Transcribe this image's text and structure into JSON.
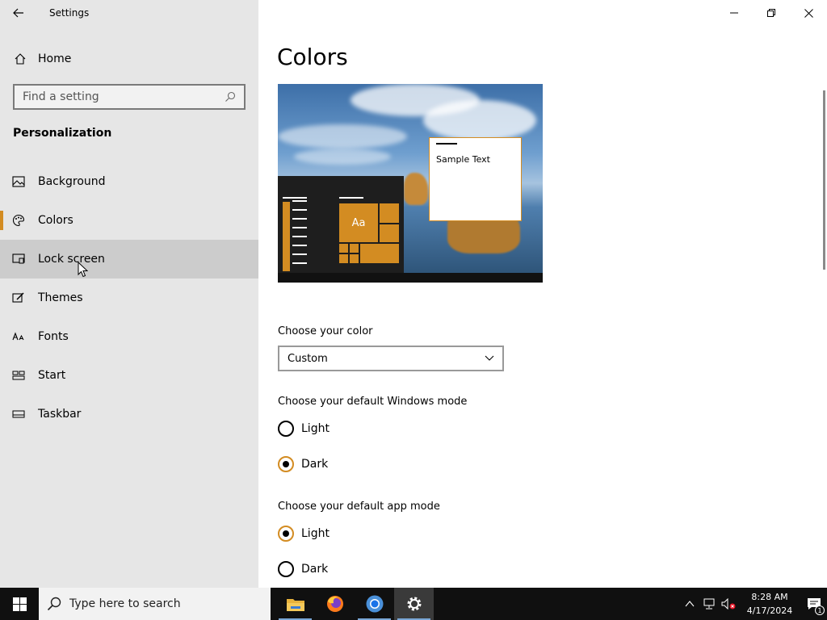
{
  "window": {
    "app_title": "Settings"
  },
  "sidebar": {
    "home_label": "Home",
    "search_placeholder": "Find a setting",
    "section_title": "Personalization",
    "items": [
      {
        "label": "Background",
        "icon": "picture-icon"
      },
      {
        "label": "Colors",
        "icon": "palette-icon",
        "selected": true
      },
      {
        "label": "Lock screen",
        "icon": "lock-screen-icon",
        "hovered": true
      },
      {
        "label": "Themes",
        "icon": "brush-icon"
      },
      {
        "label": "Fonts",
        "icon": "font-icon"
      },
      {
        "label": "Start",
        "icon": "start-icon"
      },
      {
        "label": "Taskbar",
        "icon": "taskbar-icon"
      }
    ]
  },
  "main": {
    "title": "Colors",
    "preview": {
      "tile_text": "Aa",
      "sample_text": "Sample Text"
    },
    "choose_color": {
      "label": "Choose your color",
      "value": "Custom"
    },
    "windows_mode": {
      "label": "Choose your default Windows mode",
      "options": [
        {
          "label": "Light",
          "checked": false
        },
        {
          "label": "Dark",
          "checked": true
        }
      ]
    },
    "app_mode": {
      "label": "Choose your default app mode",
      "options": [
        {
          "label": "Light",
          "checked": true
        },
        {
          "label": "Dark",
          "checked": false
        }
      ]
    }
  },
  "taskbar": {
    "search_placeholder": "Type here to search",
    "apps": [
      "file-explorer-icon",
      "firefox-icon",
      "chrome-icon",
      "settings-icon"
    ],
    "time": "8:28 AM",
    "date": "4/17/2024",
    "notification_count": "1"
  },
  "colors": {
    "accent": "#d38c22",
    "sidebar_bg": "#e6e6e6",
    "hover_bg": "#cccccc",
    "taskbar_bg": "#101010"
  }
}
